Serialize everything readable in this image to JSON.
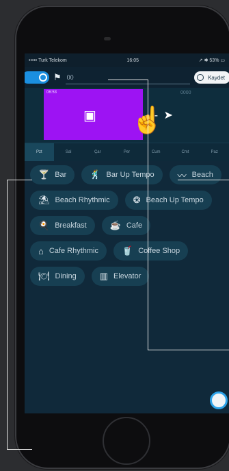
{
  "status_bar": {
    "carrier": "••••• Turk Telekom",
    "time": "16:05",
    "right": "↗ ✱ 53% ▭"
  },
  "toolbar": {
    "name_value": "00",
    "save_label": "Kaydet"
  },
  "timeline": {
    "block_time": "06:53",
    "empty_time": "0000"
  },
  "days": [
    {
      "label": "Pzt",
      "active": true
    },
    {
      "label": "Sal",
      "active": false
    },
    {
      "label": "Çar",
      "active": false
    },
    {
      "label": "Per",
      "active": false
    },
    {
      "label": "Cum",
      "active": false
    },
    {
      "label": "Cmt",
      "active": false
    },
    {
      "label": "Paz",
      "active": false
    }
  ],
  "categories": [
    {
      "label": "Bar",
      "icon": "cocktail-icon",
      "glyph": "🍸"
    },
    {
      "label": "Bar Up Tempo",
      "icon": "dancer-icon",
      "glyph": "🕺"
    },
    {
      "label": "Beach",
      "icon": "waves-icon",
      "glyph": "〰"
    },
    {
      "label": "Beach Rhythmic",
      "icon": "umbrella-icon",
      "glyph": "⛱"
    },
    {
      "label": "Beach Up Tempo",
      "icon": "beach-ball-icon",
      "glyph": "❂"
    },
    {
      "label": "Breakfast",
      "icon": "breakfast-icon",
      "glyph": "🍳"
    },
    {
      "label": "Cafe",
      "icon": "coffee-cup-icon",
      "glyph": "☕"
    },
    {
      "label": "Cafe Rhythmic",
      "icon": "cafe-building-icon",
      "glyph": "⌂"
    },
    {
      "label": "Coffee Shop",
      "icon": "takeaway-cup-icon",
      "glyph": "🥤"
    },
    {
      "label": "Dining",
      "icon": "dining-icon",
      "glyph": "🍽"
    },
    {
      "label": "Elevator",
      "icon": "elevator-icon",
      "glyph": "▥"
    }
  ],
  "colors": {
    "block": "#9d13f3",
    "accent": "#1b8fe0"
  }
}
